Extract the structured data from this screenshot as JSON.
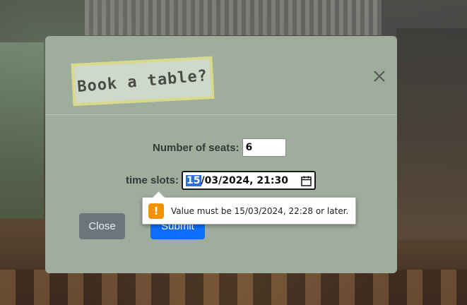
{
  "modal": {
    "title": "Book a table?",
    "close_icon": "close-x-icon"
  },
  "form": {
    "seats_label": "Number of seats:",
    "seats_value": "6",
    "time_label": "time slots:",
    "time_value_selected": "15",
    "time_value_rest": "/03/2024, 21:30",
    "calendar_icon": "calendar-icon"
  },
  "buttons": {
    "close_label": "Close",
    "submit_label": "Submit"
  },
  "validation": {
    "message": "Value must be 15/03/2024, 22:28 or later.",
    "icon": "warning-icon",
    "icon_glyph": "!"
  },
  "colors": {
    "modal_bg": "#9fae9c",
    "primary": "#0d6efd",
    "secondary": "#6d757c",
    "warning": "#f39200"
  }
}
